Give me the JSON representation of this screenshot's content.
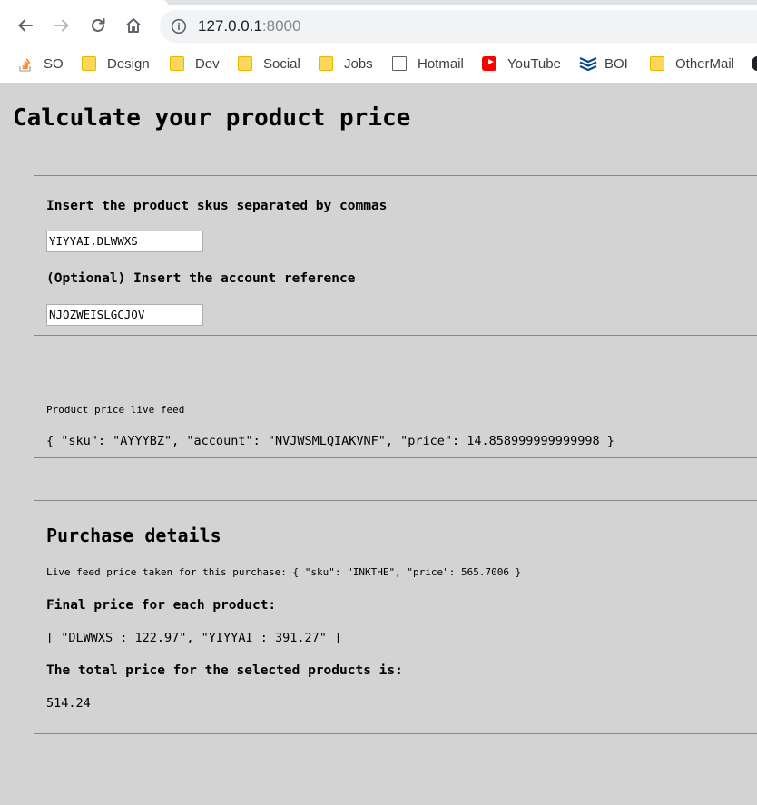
{
  "browser": {
    "url_host": "127.0.0.1",
    "url_port": ":8000",
    "bookmarks": [
      {
        "label": "SO",
        "icon": "stackoverflow-icon"
      },
      {
        "label": "Design",
        "icon": "folder-icon"
      },
      {
        "label": "Dev",
        "icon": "folder-icon"
      },
      {
        "label": "Social",
        "icon": "folder-icon"
      },
      {
        "label": "Jobs",
        "icon": "folder-icon"
      },
      {
        "label": "Hotmail",
        "icon": "document-icon"
      },
      {
        "label": "YouTube",
        "icon": "youtube-icon"
      },
      {
        "label": "BOI",
        "icon": "boi-icon"
      },
      {
        "label": "OtherMail",
        "icon": "folder-icon"
      }
    ]
  },
  "page": {
    "title": "Calculate your product price",
    "form": {
      "skus_label": "Insert the product skus separated by commas",
      "skus_value": "YIYYAI,DLWWXS",
      "account_label": "(Optional) Insert the account reference",
      "account_value": "NJOZWEISLGCJOV"
    },
    "live_feed": {
      "label": "Product price live feed",
      "value": "{ \"sku\": \"AYYYBZ\", \"account\": \"NVJWSMLQIAKVNF\", \"price\": 14.858999999999998 }"
    },
    "purchase": {
      "heading": "Purchase details",
      "feed_price_text": "Live feed price taken for this purchase: { \"sku\": \"INKTHE\", \"price\": 565.7006 }",
      "final_price_label": "Final price for each product:",
      "final_price_value": "[ \"DLWWXS : 122.97\", \"YIYYAI : 391.27\" ]",
      "total_label": "The total price for the selected products is:",
      "total_value": "514.24"
    }
  }
}
